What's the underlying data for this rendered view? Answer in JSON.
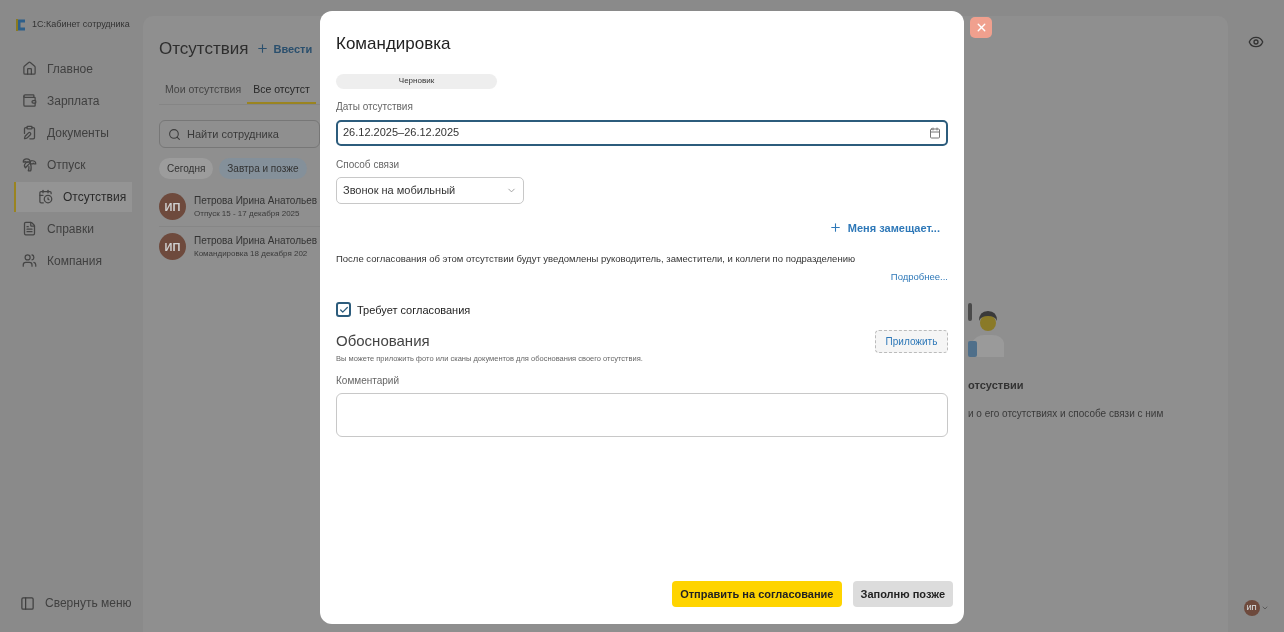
{
  "app": {
    "logo_text": "1С:Кабинет сотрудника"
  },
  "sidebar": {
    "items": [
      {
        "label": "Главное",
        "selected": false
      },
      {
        "label": "Зарплата",
        "selected": false
      },
      {
        "label": "Документы",
        "selected": false
      },
      {
        "label": "Отпуск",
        "selected": false
      },
      {
        "label": "Отсутствия",
        "selected": true
      },
      {
        "label": "Справки",
        "selected": false
      },
      {
        "label": "Компания",
        "selected": false
      }
    ],
    "collapse": "Свернуть меню"
  },
  "page": {
    "title": "Отсутствия",
    "add_link": "Ввести",
    "tabs": [
      {
        "label": "Мои отсутствия",
        "selected": false
      },
      {
        "label": "Все отсутст",
        "selected": true
      }
    ],
    "search": {
      "placeholder": "Найти сотрудника"
    },
    "chips": [
      {
        "label": "Сегодня",
        "selected": false
      },
      {
        "label": "Завтра и позже",
        "selected": true
      }
    ],
    "rows": [
      {
        "initials": "ИП",
        "name": "Петрова Ирина Анатольев",
        "detail": "Отпуск 15 - 17 декабря 2025"
      },
      {
        "initials": "ИП",
        "name": "Петрова Ирина Анатольев",
        "detail": "Командировка 18 декабря 202"
      }
    ],
    "empty_title": "отсуствии",
    "empty_text": "и о его отсутствиях и способе связи с ним"
  },
  "user": {
    "initials": "ИП"
  },
  "modal": {
    "title": "Командировка",
    "status": "Черновик",
    "dates_label": "Даты отсутствия",
    "dates_value": "26.12.2025–26.12.2025",
    "contact_label": "Способ связи",
    "contact_value": "Звонок на мобильный",
    "substitute_link": "Меня замещает...",
    "notice": "После согласования об этом отсутствии будут уведомлены руководитель, заместители, и коллеги по подразделению",
    "more_link": "Подробнее...",
    "approval": {
      "label": "Требует согласования",
      "checked": true
    },
    "grounds_title": "Обоснования",
    "attach_button": "Приложить",
    "grounds_hint": "Вы можете приложить фото или сканы документов для обоснования своего отсутствия.",
    "comment_label": "Комментарий",
    "buttons": [
      {
        "label": "Отправить на согласование",
        "kind": "primary"
      },
      {
        "label": "Заполню позже",
        "kind": "secondary"
      }
    ]
  }
}
